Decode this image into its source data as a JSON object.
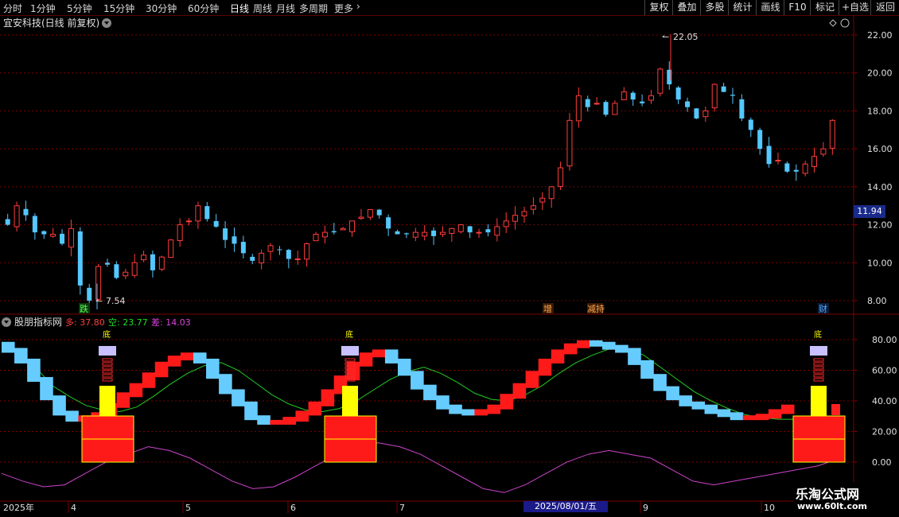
{
  "toolbar": {
    "periods": [
      "分时",
      "1分钟",
      "5分钟",
      "15分钟",
      "30分钟",
      "60分钟",
      "日线",
      "周线",
      "月线",
      "多周期",
      "更多"
    ],
    "active_period": "日线",
    "right_buttons": [
      "复权",
      "叠加",
      "多股",
      "统计",
      "画线",
      "F10",
      "+自选",
      "返回",
      "标记"
    ]
  },
  "main_panel": {
    "title": "宜安科技(日线 前复权)",
    "high_label": "22.05",
    "low_label": "7.54",
    "current_price": "11.94",
    "y_ticks": [
      "22.00",
      "20.00",
      "18.00",
      "16.00",
      "14.00",
      "12.00",
      "10.00",
      "8.00"
    ],
    "event_markers": [
      "跌",
      "增",
      "减持",
      "财"
    ]
  },
  "indicator_panel": {
    "title": "股朋指标网",
    "duo_label": "多: 37.80",
    "kong_label": "空: 23.77",
    "cha_label": "差: 14.03",
    "y_ticks": [
      "80.00",
      "60.00",
      "40.00",
      "20.00",
      "0.00"
    ],
    "signal_label": "底"
  },
  "time_axis": {
    "labels": [
      "2025年",
      "4",
      "5",
      "6",
      "7",
      "9",
      "10"
    ],
    "cursor_date": "2025/08/01/五"
  },
  "watermark": {
    "line1": "乐淘公式网",
    "line2": "www.60lt.com"
  },
  "colors": {
    "up": "#ff3c3c",
    "down": "#54c8ff",
    "grid": "#7a0000",
    "yellow": "#ffff00",
    "magenta": "#cc44cc",
    "green": "#22cc22"
  },
  "chart_data": {
    "type": "candlestick",
    "price_range": [
      7.0,
      23.0
    ],
    "indicator_range": [
      -5,
      92
    ],
    "close_series_approx": [
      12,
      13,
      12.5,
      11.6,
      11.5,
      11.5,
      11,
      11.8,
      8.8,
      8,
      9.8,
      9.9,
      9.2,
      9.5,
      10,
      10.4,
      9.6,
      10.3,
      11.2,
      12,
      12.2,
      13,
      12.3,
      11.9,
      11.2,
      11,
      10.5,
      10.1,
      10.5,
      10.9,
      10.7,
      10.2,
      10.2,
      11,
      11.5,
      11.6,
      11.6,
      11.8,
      12.2,
      12.4,
      12.8,
      12.5,
      11.8,
      11.5,
      11.5,
      11.6,
      11.6,
      11.4,
      11.6,
      11.8,
      12,
      11.6,
      11.6,
      11.6,
      11.9,
      12.2,
      12.5,
      12.7,
      13,
      13.4,
      14,
      15,
      17.5,
      18.8,
      18.2,
      18.4,
      17.8,
      18.4,
      19,
      18.6,
      18.4,
      18.8,
      20.2,
      19.4,
      18.6,
      18.2,
      17.6,
      18,
      19.4,
      19,
      18.8,
      17.6,
      17,
      16,
      15.2,
      15.4,
      14.8,
      14.8,
      15.2,
      15.6,
      16,
      17.5
    ],
    "duo_series_approx": [
      77,
      73,
      66,
      54,
      42,
      32,
      28,
      29,
      31,
      37,
      44,
      50,
      57,
      64,
      68,
      70,
      66,
      56,
      46,
      38,
      29,
      26,
      26,
      28,
      32,
      38,
      46,
      55,
      64,
      70,
      72,
      66,
      58,
      49,
      42,
      36,
      33,
      32,
      33,
      36,
      43,
      50,
      58,
      66,
      72,
      76,
      78,
      77,
      75,
      73,
      65,
      56,
      48,
      42,
      38,
      36,
      33,
      31,
      29,
      29,
      30,
      33,
      36
    ],
    "kong_series_approx": [
      75,
      72,
      62,
      50,
      43,
      37,
      34,
      33,
      36,
      43,
      51,
      58,
      63,
      65,
      60,
      52,
      44,
      38,
      34,
      33,
      35,
      40,
      47,
      54,
      59,
      62,
      58,
      52,
      45,
      41,
      40,
      44,
      50,
      58,
      65,
      70,
      74,
      74,
      70,
      62,
      54,
      46,
      40,
      35,
      31,
      29,
      28,
      28
    ],
    "cha_series_approx": [
      2,
      -2,
      -5,
      -4,
      2,
      8,
      12,
      16,
      14,
      10,
      4,
      -2,
      -6,
      -5,
      0,
      6,
      12,
      17,
      18,
      16,
      12,
      6,
      0,
      -6,
      -8,
      -4,
      2,
      8,
      12,
      14,
      12,
      10,
      4,
      -2,
      -4,
      -2,
      0,
      2,
      4,
      6,
      10
    ]
  }
}
